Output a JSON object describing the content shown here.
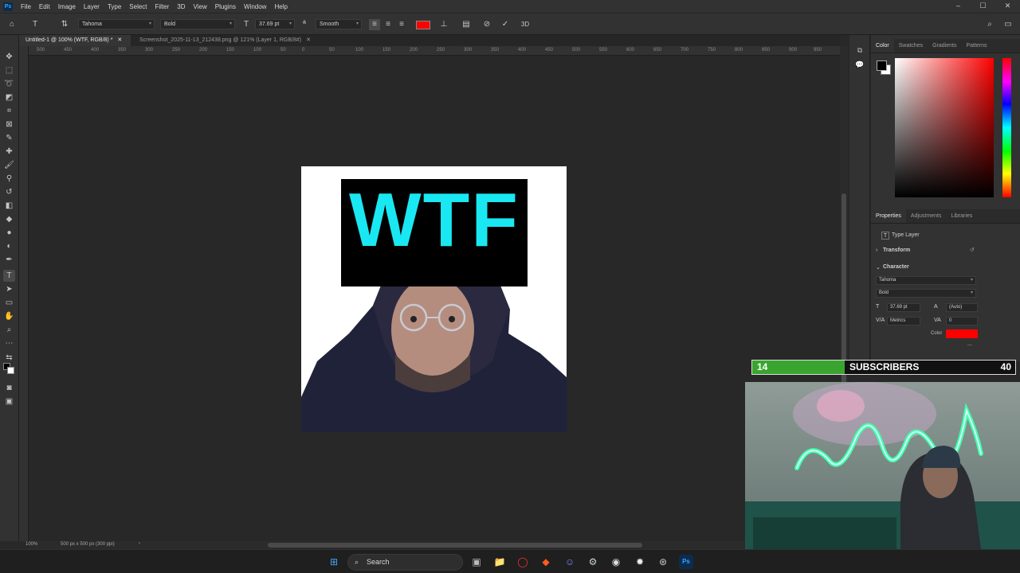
{
  "app": {
    "logo": "Ps"
  },
  "menu": [
    "File",
    "Edit",
    "Image",
    "Layer",
    "Type",
    "Select",
    "Filter",
    "3D",
    "View",
    "Plugins",
    "Window",
    "Help"
  ],
  "window_controls": {
    "minimize": "–",
    "maximize": "☐",
    "close": "✕"
  },
  "options_bar": {
    "font_family": "Tahoma",
    "font_style": "Bold",
    "font_size": "37.69 pt",
    "antialias": "Smooth",
    "text_color": "#ff0000"
  },
  "tabs": [
    {
      "label": "Untitled-1 @ 100% (WTF, RGB/8) *",
      "close": "✕"
    },
    {
      "label": "Screenshot_2025-11-13_212438.png @ 121% (Layer 1, RGB/8#)",
      "close": "✕"
    }
  ],
  "ruler_ticks": [
    "500",
    "450",
    "400",
    "350",
    "300",
    "250",
    "200",
    "150",
    "100",
    "50",
    "0",
    "50",
    "100",
    "150",
    "200",
    "250",
    "300",
    "350",
    "400",
    "450",
    "500",
    "550",
    "600",
    "650",
    "700",
    "750",
    "800",
    "850",
    "900",
    "950",
    "1000"
  ],
  "canvas": {
    "text": "WTF",
    "text_color": "#19e8f2"
  },
  "status": {
    "zoom": "100%",
    "doc_size": "500 px x 500 px (300 ppi)"
  },
  "color_panel": {
    "tabs": [
      "Color",
      "Swatches",
      "Gradients",
      "Patterns"
    ],
    "fg": "#000000",
    "bg": "#ffffff"
  },
  "properties_panel": {
    "tabs": [
      "Properties",
      "Adjustments",
      "Libraries"
    ],
    "layer_kind": "Type Layer",
    "sections": {
      "transform": "Transform",
      "character": "Character"
    },
    "font_family": "Tahoma",
    "font_style": "Bold",
    "font_size": "37.69 pt",
    "leading": "(Auto)",
    "kerning": "Metrics",
    "tracking": "0",
    "color_label": "Color",
    "color": "#ff0000",
    "more": "..."
  },
  "subscriber_goal": {
    "current": "14",
    "label": "SUBSCRIBERS",
    "goal": "40",
    "progress": 0.35
  },
  "taskbar": {
    "search_placeholder": "Search"
  }
}
